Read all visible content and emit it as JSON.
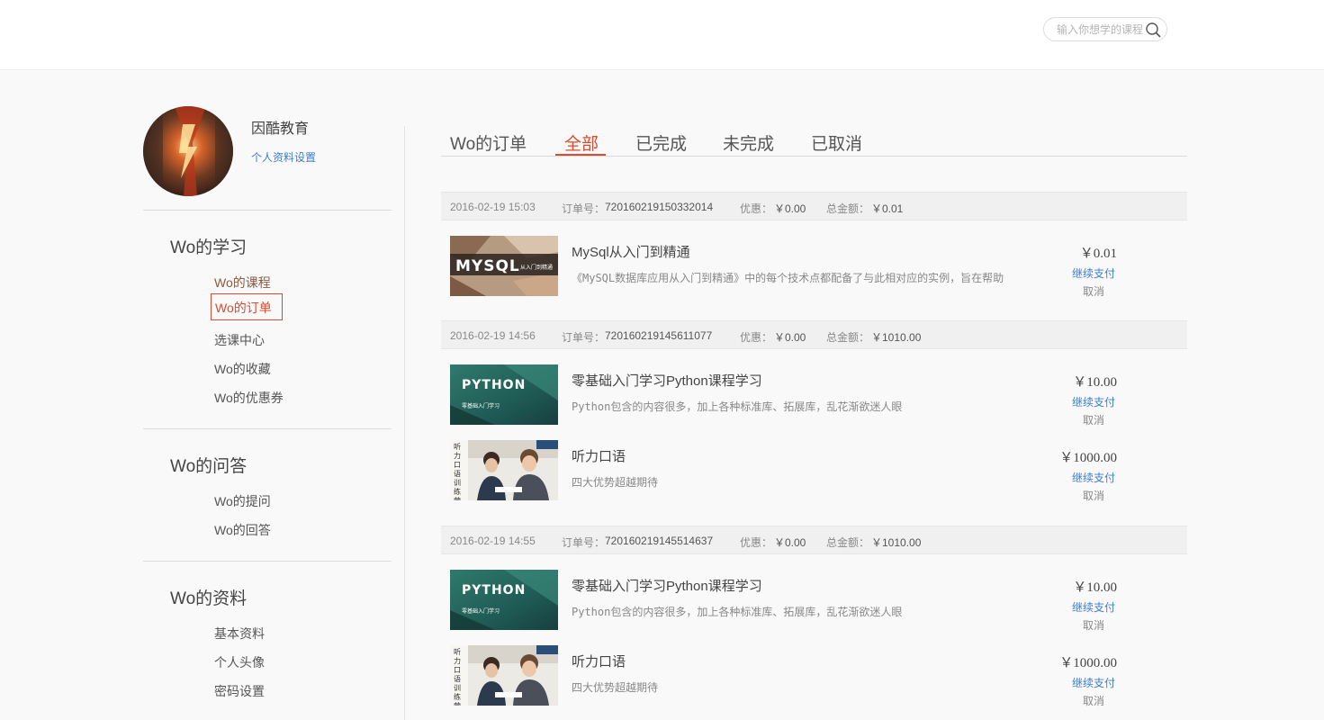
{
  "header": {
    "search_placeholder": "输入你想学的课程"
  },
  "sidebar": {
    "username": "因酷教育",
    "profile_link": "个人资料设置",
    "sections": [
      {
        "title": "Wo的学习",
        "items": [
          "Wo的课程",
          "Wo的订单",
          "选课中心",
          "Wo的收藏",
          "Wo的优惠券"
        ]
      },
      {
        "title": "Wo的问答",
        "items": [
          "Wo的提问",
          "Wo的回答"
        ]
      },
      {
        "title": "Wo的资料",
        "items": [
          "基本资料",
          "个人头像",
          "密码设置"
        ]
      }
    ],
    "active_item": "Wo的订单"
  },
  "tabs": {
    "title": "Wo的订单",
    "items": [
      "全部",
      "已完成",
      "未完成",
      "已取消"
    ],
    "active": "全部"
  },
  "orders": [
    {
      "date": "2016-02-19 15:03",
      "order_label": "订单号：",
      "order_no": "720160219150332014",
      "discount_label": "优惠：",
      "discount": "￥0.00",
      "total_label": "总金额：",
      "total": "￥0.01",
      "items": [
        {
          "title": "MySql从入门到精通",
          "desc": "《MySQL数据库应用从入门到精通》中的每个技术点都配备了与此相对应的实例，旨在帮助",
          "price": "￥0.01",
          "pay": "继续支付",
          "cancel": "取消",
          "thumb_text": "MYSQL",
          "thumb_sub": "从入门到精通"
        }
      ]
    },
    {
      "date": "2016-02-19 14:56",
      "order_label": "订单号：",
      "order_no": "720160219145611077",
      "discount_label": "优惠：",
      "discount": "￥0.00",
      "total_label": "总金额：",
      "total": "￥1010.00",
      "items": [
        {
          "title": "零基础入门学习Python课程学习",
          "desc": "Python包含的内容很多，加上各种标准库、拓展库，乱花渐欲迷人眼",
          "price": "￥10.00",
          "pay": "继续支付",
          "cancel": "取消",
          "thumb_text": "PYTHON",
          "thumb_sub": "零基础入门学习"
        },
        {
          "title": "听力口语",
          "desc": "四大优势超越期待",
          "price": "￥1000.00",
          "pay": "继续支付",
          "cancel": "取消",
          "thumb_text": "听力口语训练营"
        }
      ]
    },
    {
      "date": "2016-02-19 14:55",
      "order_label": "订单号：",
      "order_no": "720160219145514637",
      "discount_label": "优惠：",
      "discount": "￥0.00",
      "total_label": "总金额：",
      "total": "￥1010.00",
      "items": [
        {
          "title": "零基础入门学习Python课程学习",
          "desc": "Python包含的内容很多，加上各种标准库、拓展库，乱花渐欲迷人眼",
          "price": "￥10.00",
          "pay": "继续支付",
          "cancel": "取消",
          "thumb_text": "PYTHON",
          "thumb_sub": "零基础入门学习"
        },
        {
          "title": "听力口语",
          "desc": "四大优势超越期待",
          "price": "￥1000.00",
          "pay": "继续支付",
          "cancel": "取消",
          "thumb_text": "听力口语训练营"
        }
      ]
    }
  ]
}
